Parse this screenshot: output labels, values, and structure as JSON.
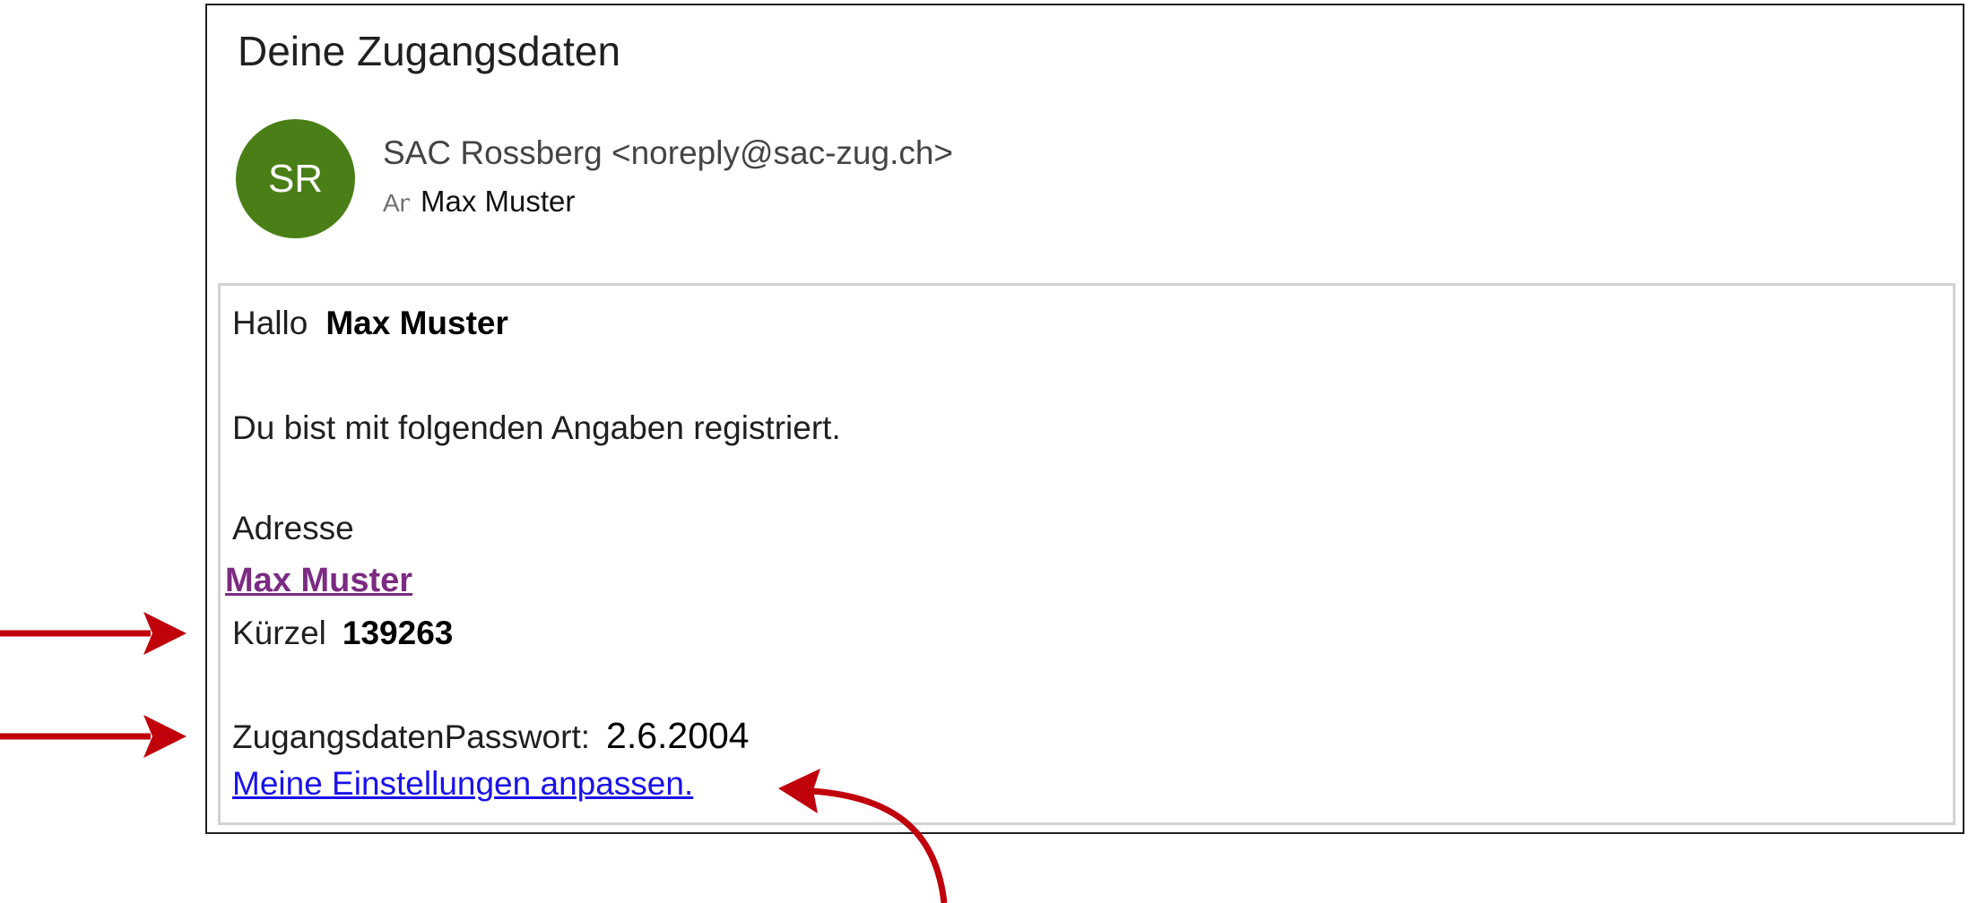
{
  "email": {
    "subject": "Deine Zugangsdaten",
    "avatar_initials": "SR",
    "avatar_color": "#4a7f17",
    "sender": "SAC Rossberg <noreply@sac-zug.ch>",
    "recipient_prefix": "An",
    "recipient_name": "Max Muster"
  },
  "body": {
    "greeting": "Hallo",
    "greeting_name": "Max Muster",
    "intro": "Du bist mit folgenden Angaben registriert.",
    "address_label": "Adresse",
    "address_name": "Max Muster",
    "kuerzel_label": "Kürzel",
    "kuerzel_value": "139263",
    "password_label": "ZugangsdatenPasswort:",
    "password_value": "2.6.2004",
    "settings_link": "Meine Einstellungen anpassen."
  },
  "annotations": {
    "arrow_color": "#c0000b"
  }
}
